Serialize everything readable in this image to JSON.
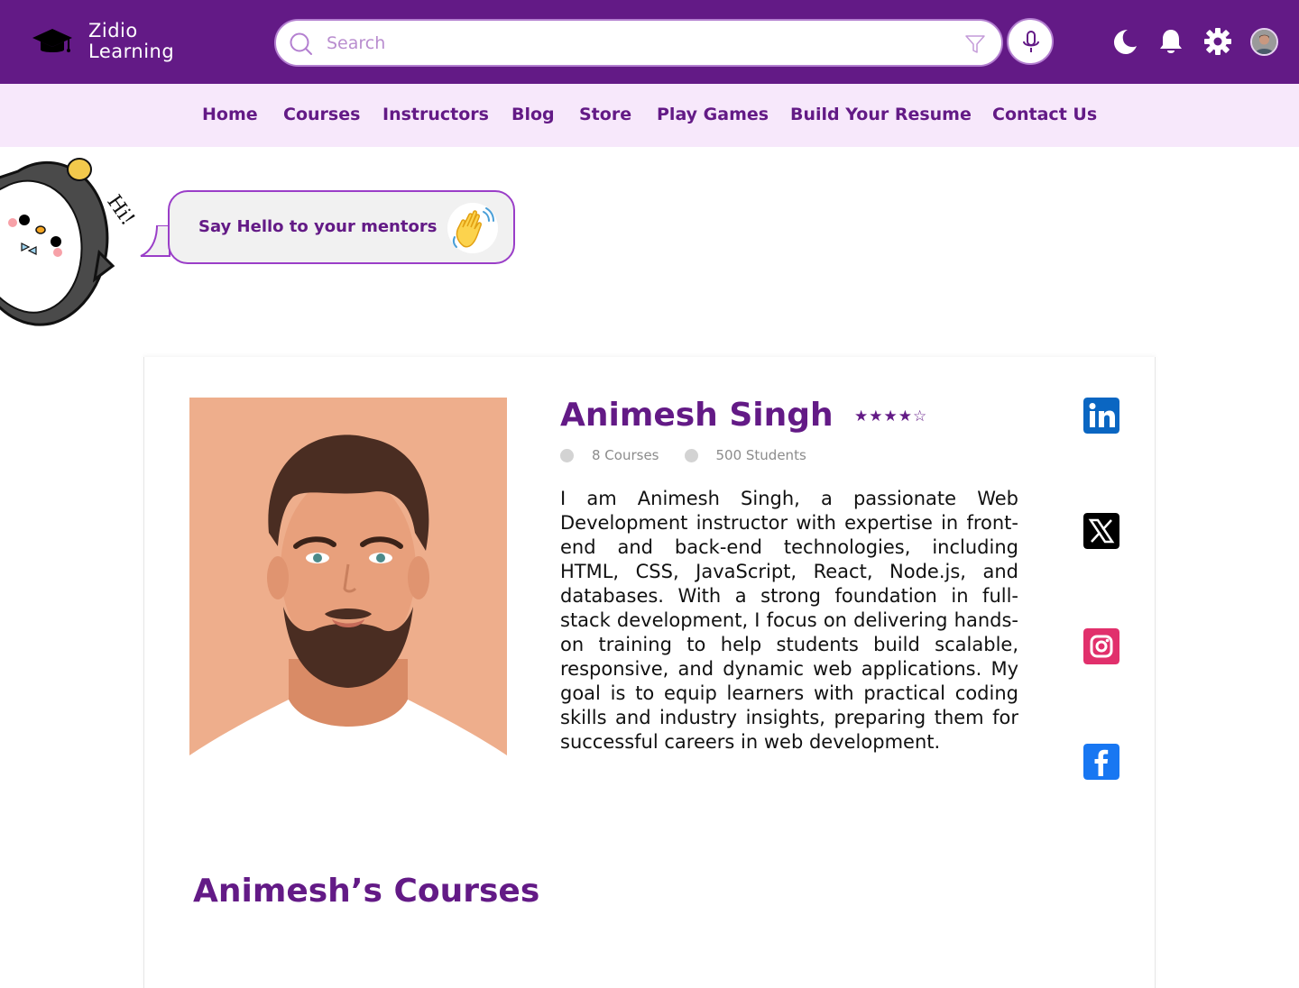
{
  "header": {
    "brand_line1": "Zidio",
    "brand_line2": "Learning",
    "search_placeholder": "Search"
  },
  "nav": {
    "items": [
      "Home",
      "Courses",
      "Instructors",
      "Blog",
      "Store",
      "Play Games",
      "Build Your Resume",
      "Contact Us"
    ]
  },
  "greeting": {
    "hi": "Hi!",
    "message": "Say Hello to your mentors"
  },
  "instructor": {
    "name": "Animesh Singh",
    "stars": "★★★★☆",
    "courses": "8 Courses",
    "students": "500 Students",
    "bio": "I am Animesh Singh, a passionate Web Development instructor with expertise in front-end and back-end technologies, including HTML, CSS, JavaScript, React, Node.js, and databases. With a strong foundation in full-stack development, I focus on delivering hands-on training to help students build scalable, responsive, and dynamic web applications. My goal is to equip learners with practical coding skills and industry insights, preparing them for successful careers in web development."
  },
  "courses_section": {
    "title": "Animesh’s Courses"
  },
  "colors": {
    "brand": "#631a86",
    "nav_bg": "#f7e8fb",
    "linkedin": "#0a66c2",
    "x": "#000000",
    "instagram": "#e1306c",
    "facebook": "#1877f2"
  },
  "icons": [
    "graduation-cap-icon",
    "search-icon",
    "filter-icon",
    "microphone-icon",
    "moon-icon",
    "bell-icon",
    "gear-icon",
    "linkedin-icon",
    "x-icon",
    "instagram-icon",
    "facebook-icon",
    "waving-hand-icon"
  ]
}
